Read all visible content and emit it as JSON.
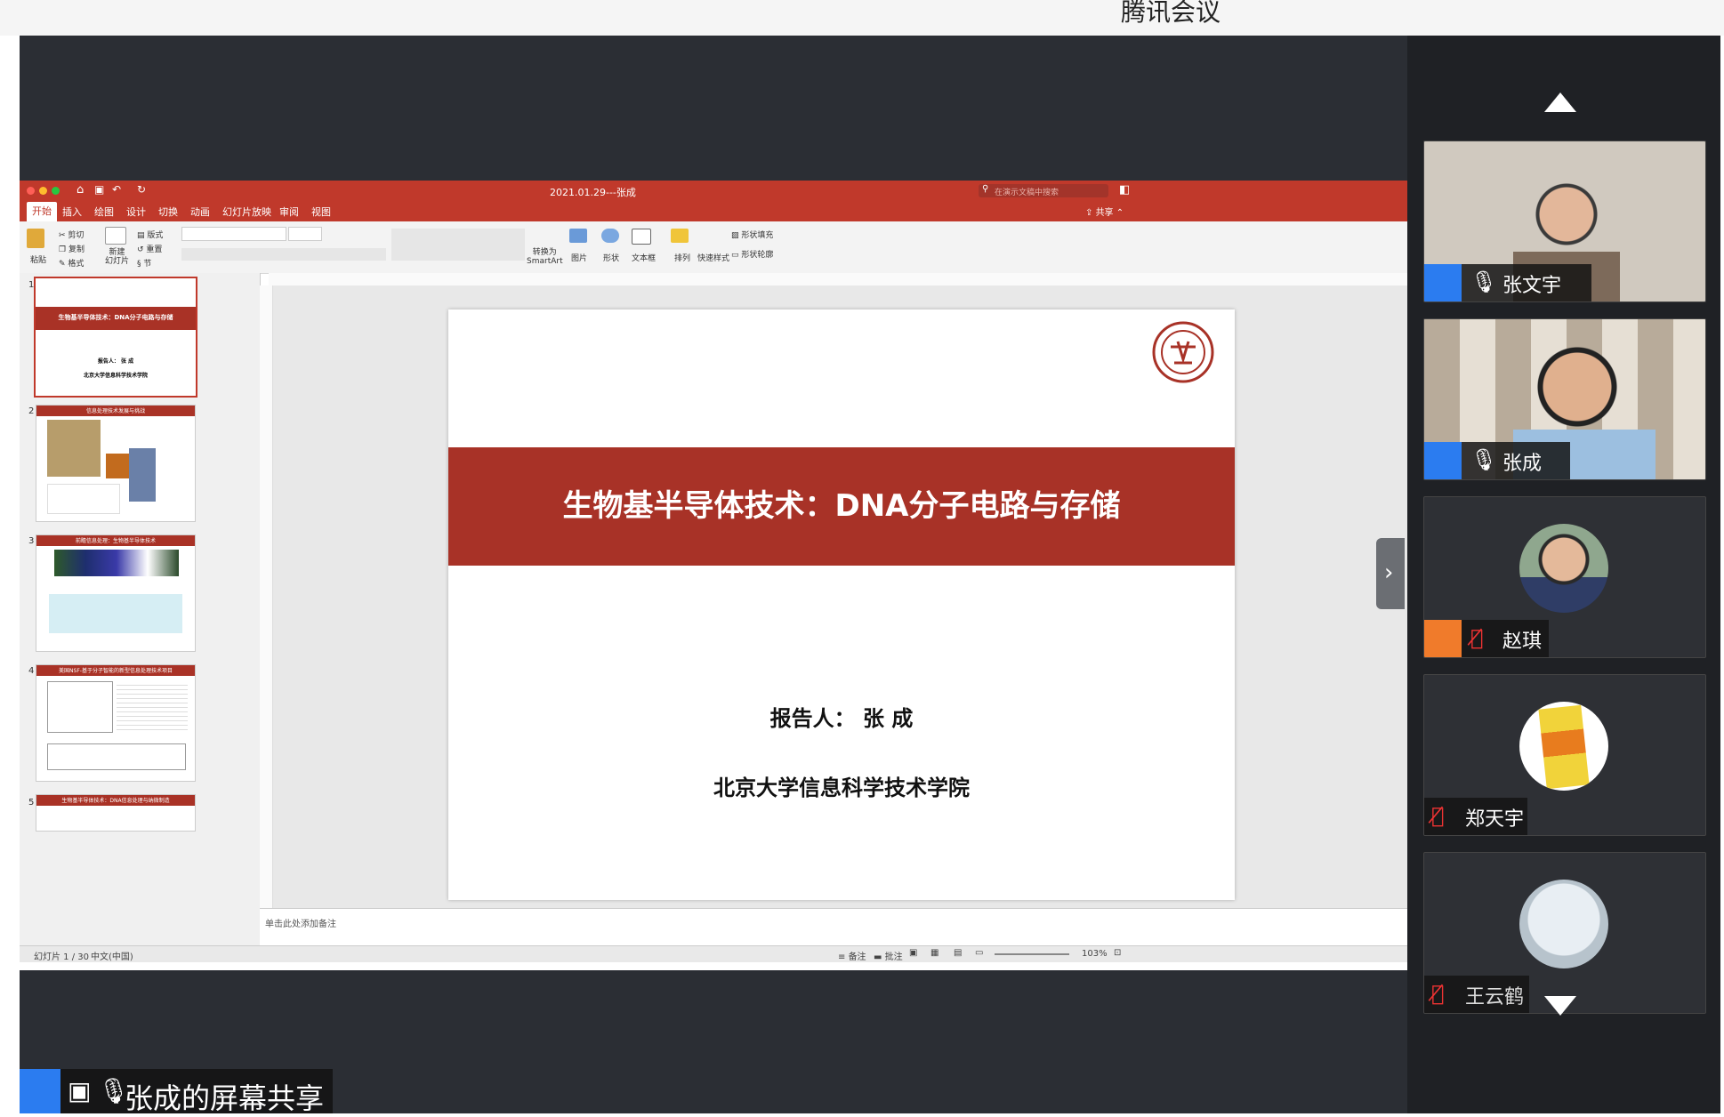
{
  "app": {
    "title": "腾讯会议"
  },
  "ppt": {
    "doc_title": "2021.01.29---张成",
    "search_placeholder": "在演示文稿中搜索",
    "share_label": "共享",
    "tabs": [
      "开始",
      "插入",
      "绘图",
      "设计",
      "切换",
      "动画",
      "幻灯片放映",
      "审阅",
      "视图"
    ],
    "ribbon": {
      "paste": "粘贴",
      "cut": "剪切",
      "copy": "复制",
      "format": "格式",
      "new_slide": "新建\n幻灯片",
      "layout": "版式",
      "reset": "重置",
      "section": "节",
      "smartart": "转换为\nSmartArt",
      "picture": "图片",
      "shape": "形状",
      "textbox": "文本框",
      "arrange": "排列",
      "quick_styles": "快速样式",
      "shape_fill": "形状填充",
      "shape_outline": "形状轮廓"
    },
    "thumbnails": [
      {
        "num": "1",
        "title": "生物基半导体技术：DNA分子电路与存储",
        "line1": "报告人： 张 成",
        "line2": "北京大学信息科学技术学院"
      },
      {
        "num": "2",
        "title": "信息处理技术发展与挑战"
      },
      {
        "num": "3",
        "title": "前瞻信息处理：生物基半导体技术"
      },
      {
        "num": "4",
        "title": "美国NSF-基于分子智能的新型信息处理技术项目"
      },
      {
        "num": "5",
        "title": "生物基半导体技术：DNA信息处理与纳微制造"
      }
    ],
    "notes_placeholder": "单击此处添加备注",
    "status": {
      "slide_count": "幻灯片 1 / 30",
      "language": "中文(中国)",
      "notes": "备注",
      "comments": "批注",
      "zoom": "103%"
    },
    "slide": {
      "title": "生物基半导体技术：DNA分子电路与存储",
      "speaker": "报告人：  张  成",
      "institution": "北京大学信息科学技术学院"
    }
  },
  "participants": [
    {
      "name": "张文宇",
      "muted": false
    },
    {
      "name": "张成",
      "muted": false
    },
    {
      "name": "赵琪",
      "muted": true
    },
    {
      "name": "郑天宇",
      "muted": true
    },
    {
      "name": "王云鹤",
      "muted": true
    }
  ],
  "screen_share": {
    "label": "张成的屏幕共享"
  },
  "colors": {
    "accent_red": "#a83227",
    "tencent_blue": "#2b7cf0",
    "stage_bg": "#2b2e34"
  }
}
